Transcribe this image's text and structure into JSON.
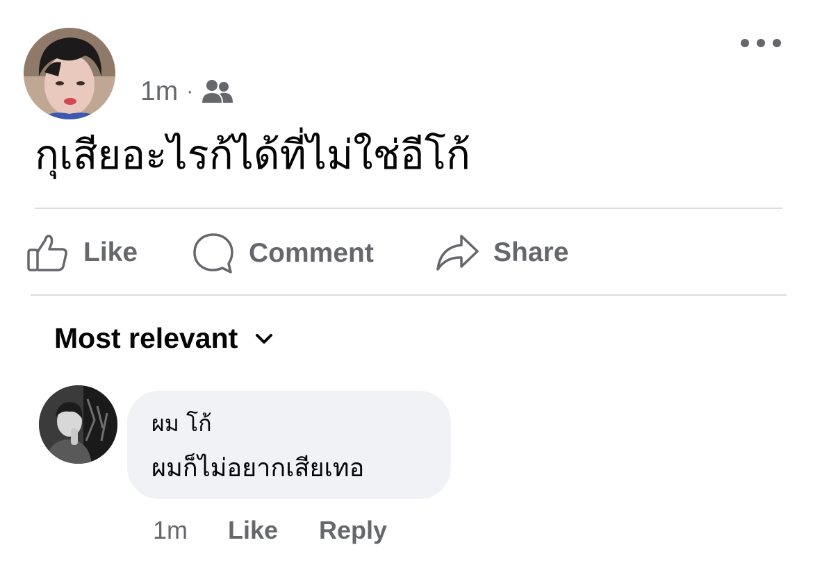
{
  "post": {
    "time": "1m",
    "separator": "·",
    "audience_icon": "friends-icon",
    "text": "กุเสียอะไรก้ได้ที่ไม่ใช่อีโก้",
    "more_icon": "more-options-icon"
  },
  "actions": {
    "like_label": "Like",
    "comment_label": "Comment",
    "share_label": "Share"
  },
  "comments_section": {
    "sort_label": "Most relevant"
  },
  "comment": {
    "author": "ผม โก้",
    "text": "ผมก็ไม่อยากเสียเทอ",
    "time": "1m",
    "like_label": "Like",
    "reply_label": "Reply"
  },
  "colors": {
    "secondary_text": "#65676b",
    "primary_text": "#050505",
    "bubble": "#f0f2f5",
    "divider": "#dadde1"
  }
}
